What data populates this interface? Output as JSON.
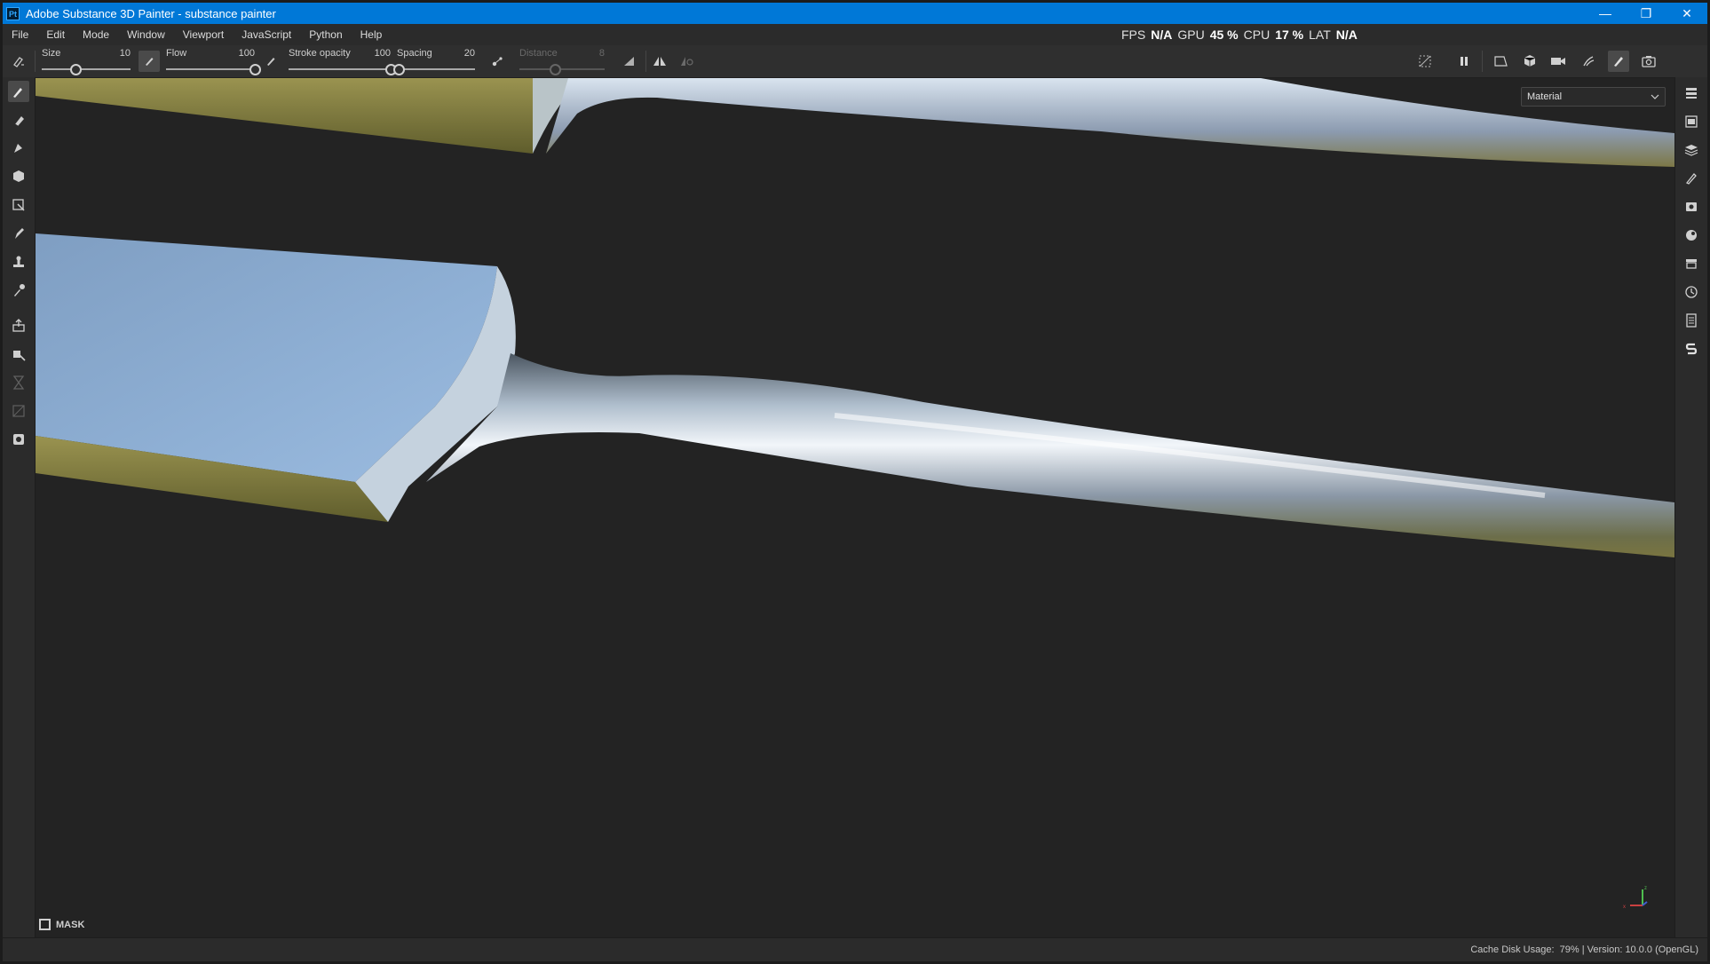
{
  "window": {
    "app_icon": "Pt",
    "title": "Adobe Substance 3D Painter - substance painter",
    "controls": {
      "minimize": "—",
      "restore": "❐",
      "close": "✕"
    }
  },
  "menu": {
    "items": [
      "File",
      "Edit",
      "Mode",
      "Window",
      "Viewport",
      "JavaScript",
      "Python",
      "Help"
    ]
  },
  "performance": {
    "fps_label": "FPS",
    "fps_value": "N/A",
    "gpu_label": "GPU",
    "gpu_value": "45 %",
    "cpu_label": "CPU",
    "cpu_value": "17 %",
    "lat_label": "LAT",
    "lat_value": "N/A"
  },
  "tool_options": {
    "size": {
      "label": "Size",
      "value": "10",
      "fraction": 0.38
    },
    "flow": {
      "label": "Flow",
      "value": "100",
      "fraction": 1.0
    },
    "stroke_opacity": {
      "label": "Stroke opacity",
      "value": "100",
      "fraction": 1.0
    },
    "spacing": {
      "label": "Spacing",
      "value": "20",
      "fraction": 0.02
    },
    "distance": {
      "label": "Distance",
      "value": "8",
      "fraction": 0.42,
      "enabled": false
    }
  },
  "icons": {
    "lazy_mouse": "brush-icon",
    "pause": "pause-icon",
    "camera": "camera-icon"
  },
  "viewport": {
    "mode_select": "Material",
    "mask_label": "MASK",
    "axis_labels": {
      "x": "x",
      "y": "y",
      "z": "z"
    },
    "colors": {
      "background": "#232323",
      "metal": "#b9c8d8",
      "metal_edge": "#8a8540"
    }
  },
  "status": {
    "cache_label": "Cache Disk Usage:",
    "cache_value": "79%",
    "separator": "|",
    "version": "Version: 10.0.0 (OpenGL)"
  }
}
